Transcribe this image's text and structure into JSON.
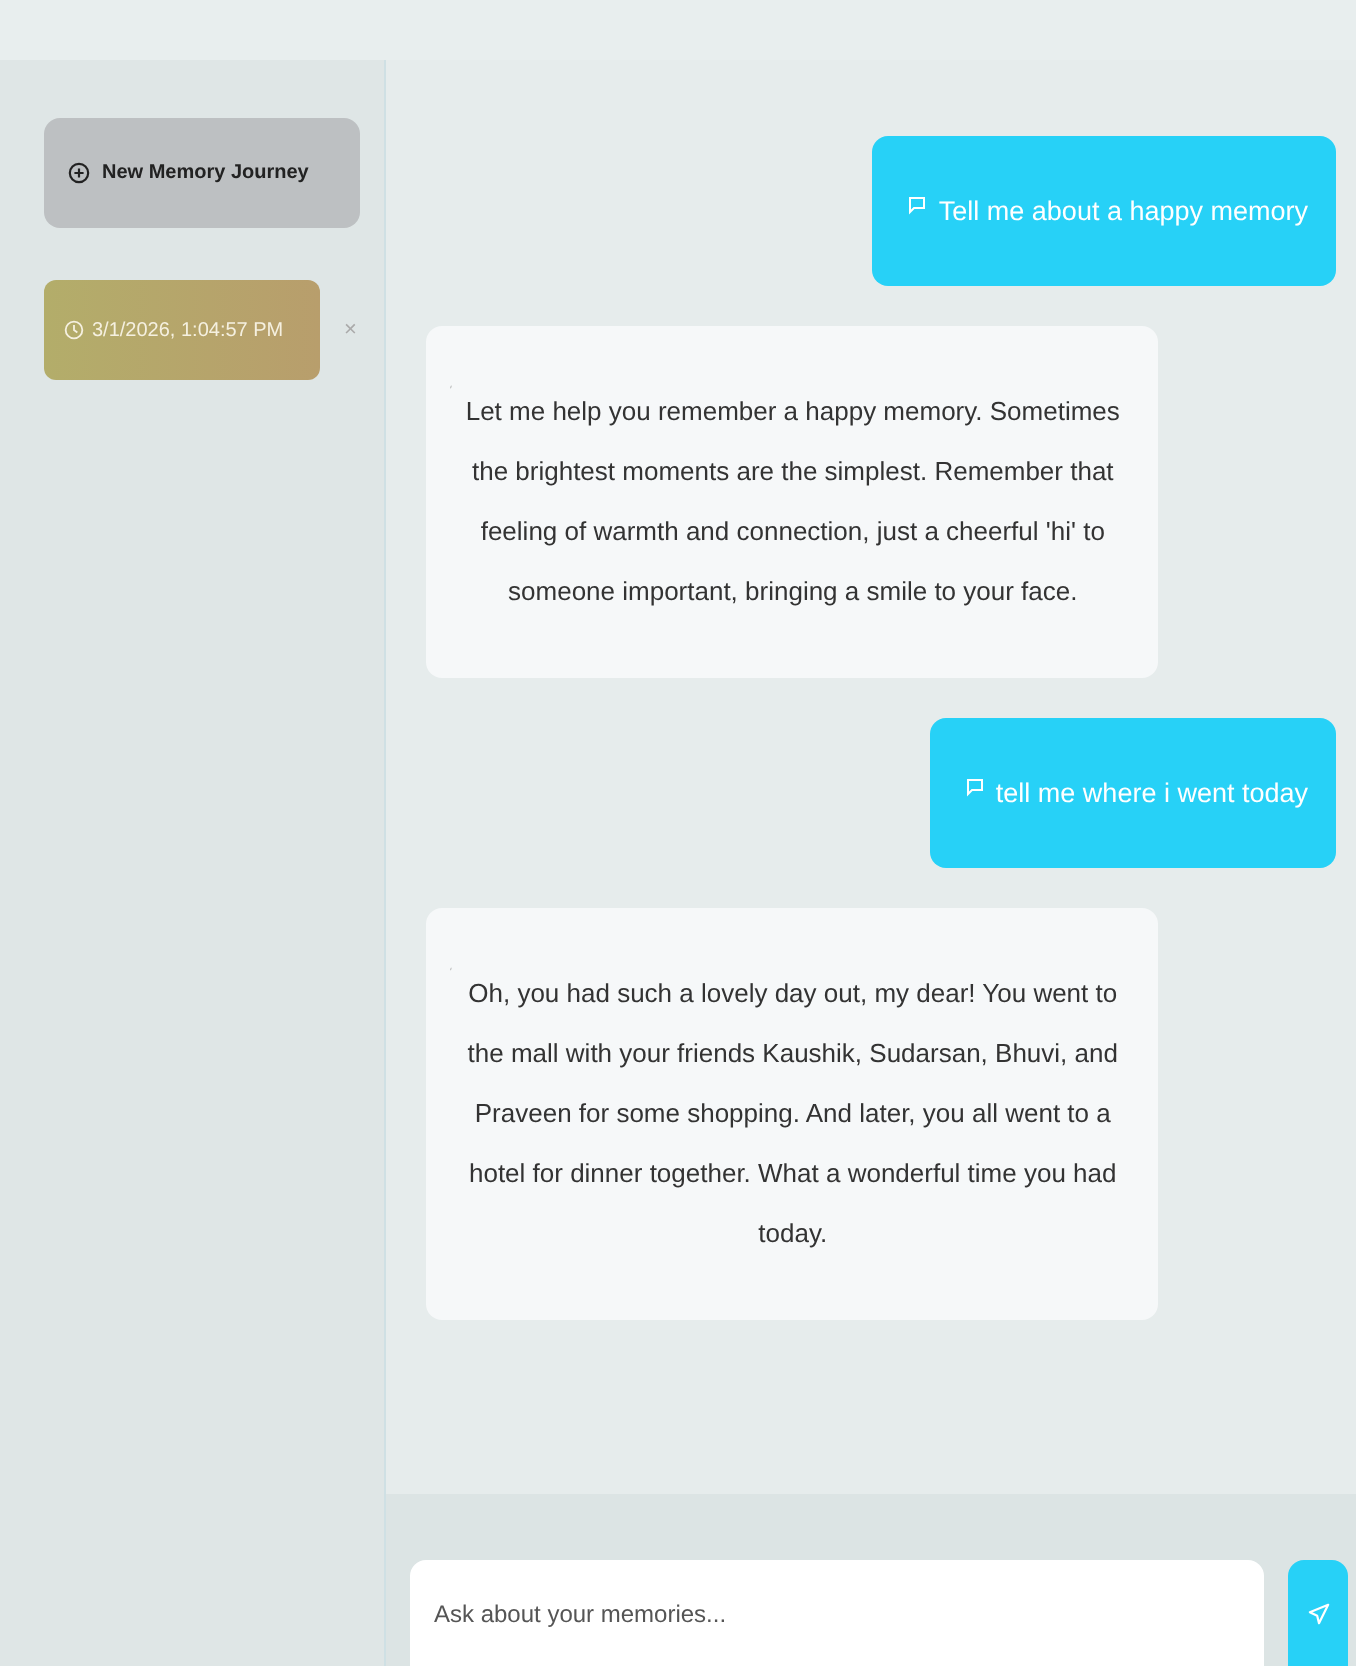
{
  "sidebar": {
    "new_button": {
      "label": "New Memory Journey"
    },
    "sessions": [
      {
        "label": "3/1/2026, 1:04:57 PM",
        "selected": true,
        "close": "×"
      }
    ]
  },
  "messages": [
    {
      "kind": "user",
      "text": "Tell me about a happy memory"
    },
    {
      "kind": "assistant",
      "text": "Let me help you remember a happy memory. Sometimes the brightest moments are the simplest. Remember that feeling of warmth and connection, just a cheerful 'hi' to someone important, bringing a smile to your face."
    },
    {
      "kind": "user",
      "text": "tell me where i went today"
    },
    {
      "kind": "assistant",
      "text": "Oh, you had such a lovely day out, my dear! You went to the mall with your friends Kaushik, Sudarsan, Bhuvi, and Praveen for some shopping. And later, you all went to a hotel for dinner together. What a wonderful time you had today."
    }
  ],
  "input": {
    "placeholder": "Ask about your memories..."
  }
}
